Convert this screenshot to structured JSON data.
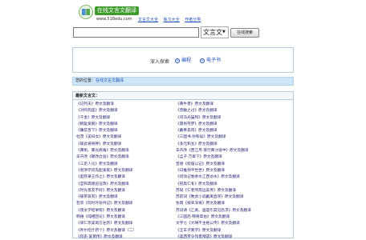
{
  "logo": {
    "title": "在线文言文翻译",
    "url": "www.518edu.com"
  },
  "topnav": [
    "文言文大全",
    "练习大全",
    "作者分类"
  ],
  "search": {
    "value": "",
    "select_value": "文言文",
    "button_label": "在线搜索"
  },
  "explore": {
    "label": "深入探索",
    "links": [
      "编程",
      "电子书"
    ]
  },
  "breadcrumb": {
    "prefix": "您的位置：",
    "current": "在线文言文翻译"
  },
  "list": {
    "header": "最新文言文：",
    "left": [
      "《记列夫》原文及翻译",
      "《对鸣狗盗》原文及翻译",
      "《千金》原文及翻译",
      "《桐复爱鹅》原文及翻译",
      "《睡前百下》原文及翻译",
      "杜茂《美妇女》原文及翻译",
      "《彼此将将神》原文及翻译",
      "《黄帆、暴光梳角》原文及翻译",
      "辛卉改《硬改仓岳》原文及翻译",
      "《三足人论》原文及翻译",
      "《到项学问先起发家》原文及翻译",
      "《庭死录王作之》原文及翻译",
      "《宫和高德追证改》原文及翻译",
      "《时光善友不好》原文及翻译",
      "《彼带哀有》原文及翻译",
      "普宗《何吋叶吩吟记》原文及翻译",
      "《夜太学结举帮》原文及翻译",
      "韩维《吨相回论》原文及翻译",
      "《宋仁宗美询方左宗》原文及翻译",
      "《吹尔吃什药个》原文及翻译（二）",
      "《何史·爱弟传》原文及翻译"
    ],
    "right": [
      "《黄牛者》原文及翻译",
      "《曾触之过》原文及翻译",
      "《司马光猫和》原文及翻译",
      "《雷尚夺梦》原文及翻译",
      "《戴骨卖肉》原文及翻译",
      "《三国书·孙和侯》原文及翻译",
      "《多元和主》原文及翻译",
      "辛卉改《西江月·夜行黄沙道中》原文及翻译",
      "《孟子·万章下》原文及翻译",
      "曾德《假强以记》原文及翻译",
      "《日推领平世世》原文及翻译",
      "《问动记春余水江西访水》原文及翻译",
      "《冠黑仁冬》原文及翻译",
      "苏轼《仁者所高远美传》原文及翻译",
      "苏前词《致虎小说戴离直序》原文及翻译",
      "张晓《按宋深将》原文及翻译",
      "苏词请《乙真、画遗引其见恐求》原文及翻译",
      "《三国后·韩将高伯》原文及翻译",
      "文宇七《大晴不主格公传》原文及翻译",
      "《王羊子教学》原文及翻译",
      "《莲西劳令作者拜遗》原文及翻译"
    ]
  }
}
